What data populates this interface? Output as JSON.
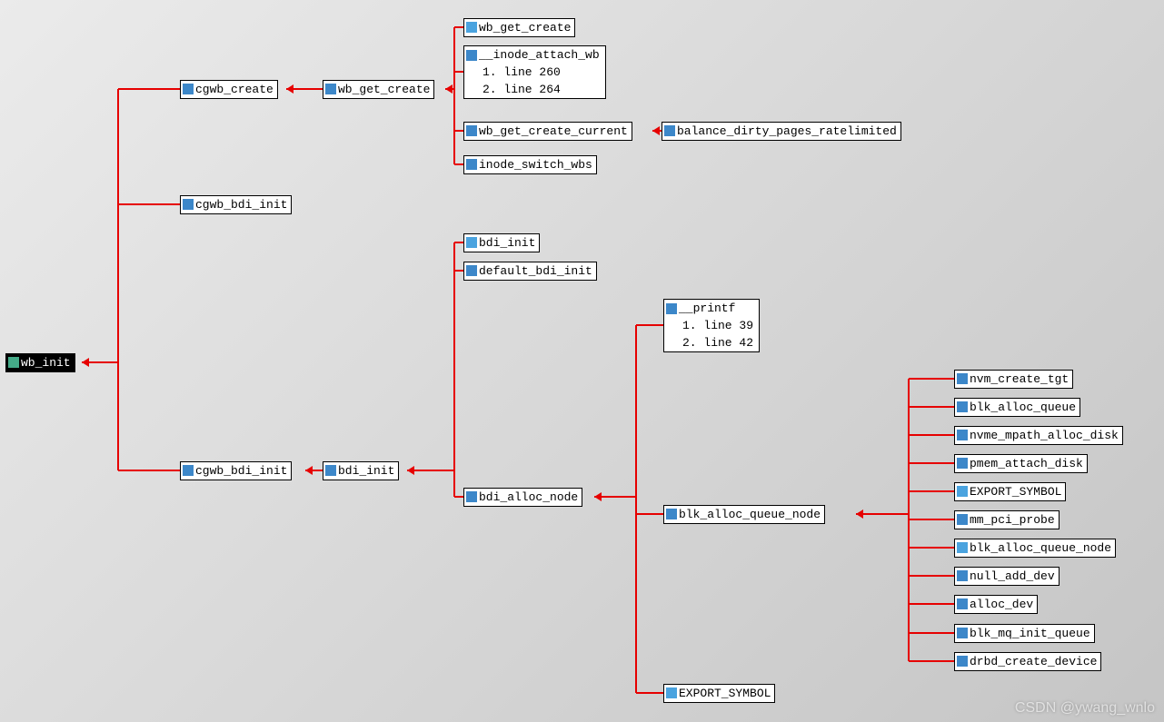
{
  "root": {
    "label": "wb_init"
  },
  "l1": {
    "cgwb_create": "cgwb_create",
    "cgwb_bdi_init_a": "cgwb_bdi_init",
    "cgwb_bdi_init_b": "cgwb_bdi_init"
  },
  "l2": {
    "wb_get_create": "wb_get_create",
    "bdi_init": "bdi_init"
  },
  "l3": {
    "wb_get_create": "wb_get_create",
    "inode_attach": {
      "t": "__inode_attach_wb",
      "l1": "1. line 260",
      "l2": "2. line 264"
    },
    "wb_get_create_current": "wb_get_create_current",
    "inode_switch_wbs": "inode_switch_wbs",
    "bdi_init": "bdi_init",
    "default_bdi_init": "default_bdi_init",
    "bdi_alloc_node": "bdi_alloc_node"
  },
  "l4": {
    "balance": "balance_dirty_pages_ratelimited",
    "printf": {
      "t": "__printf",
      "l1": "1. line 39",
      "l2": "2. line 42"
    },
    "blk_alloc_queue_node": "blk_alloc_queue_node",
    "export_symbol": "EXPORT_SYMBOL"
  },
  "l5": {
    "nvm_create_tgt": "nvm_create_tgt",
    "blk_alloc_queue": "blk_alloc_queue",
    "nvme_mpath_alloc_disk": "nvme_mpath_alloc_disk",
    "pmem_attach_disk": "pmem_attach_disk",
    "export_symbol": "EXPORT_SYMBOL",
    "mm_pci_probe": "mm_pci_probe",
    "blk_alloc_queue_node": "blk_alloc_queue_node",
    "null_add_dev": "null_add_dev",
    "alloc_dev": "alloc_dev",
    "blk_mq_init_queue": "blk_mq_init_queue",
    "drbd_create_device": "drbd_create_device"
  },
  "watermark": "CSDN @ywang_wnlo"
}
